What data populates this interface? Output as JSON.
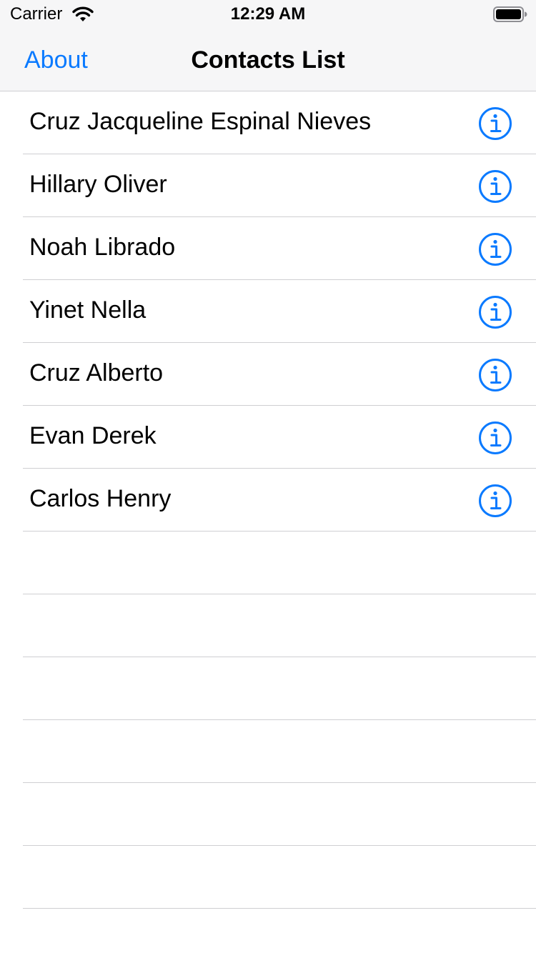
{
  "status_bar": {
    "carrier": "Carrier",
    "time": "12:29 AM",
    "wifi_icon": "wifi-icon",
    "battery_icon": "battery-icon"
  },
  "nav": {
    "left_button": "About",
    "title": "Contacts List"
  },
  "contacts": [
    {
      "name": "Cruz Jacqueline Espinal Nieves"
    },
    {
      "name": "Hillary Oliver"
    },
    {
      "name": "Noah Librado"
    },
    {
      "name": "Yinet Nella"
    },
    {
      "name": "Cruz Alberto"
    },
    {
      "name": "Evan Derek"
    },
    {
      "name": "Carlos Henry"
    }
  ],
  "empty_rows": 6,
  "colors": {
    "accent": "#0a7aff",
    "bar_background": "#f6f6f7",
    "separator": "#cfcfd2"
  },
  "icons": {
    "row_accessory": "info-icon"
  }
}
